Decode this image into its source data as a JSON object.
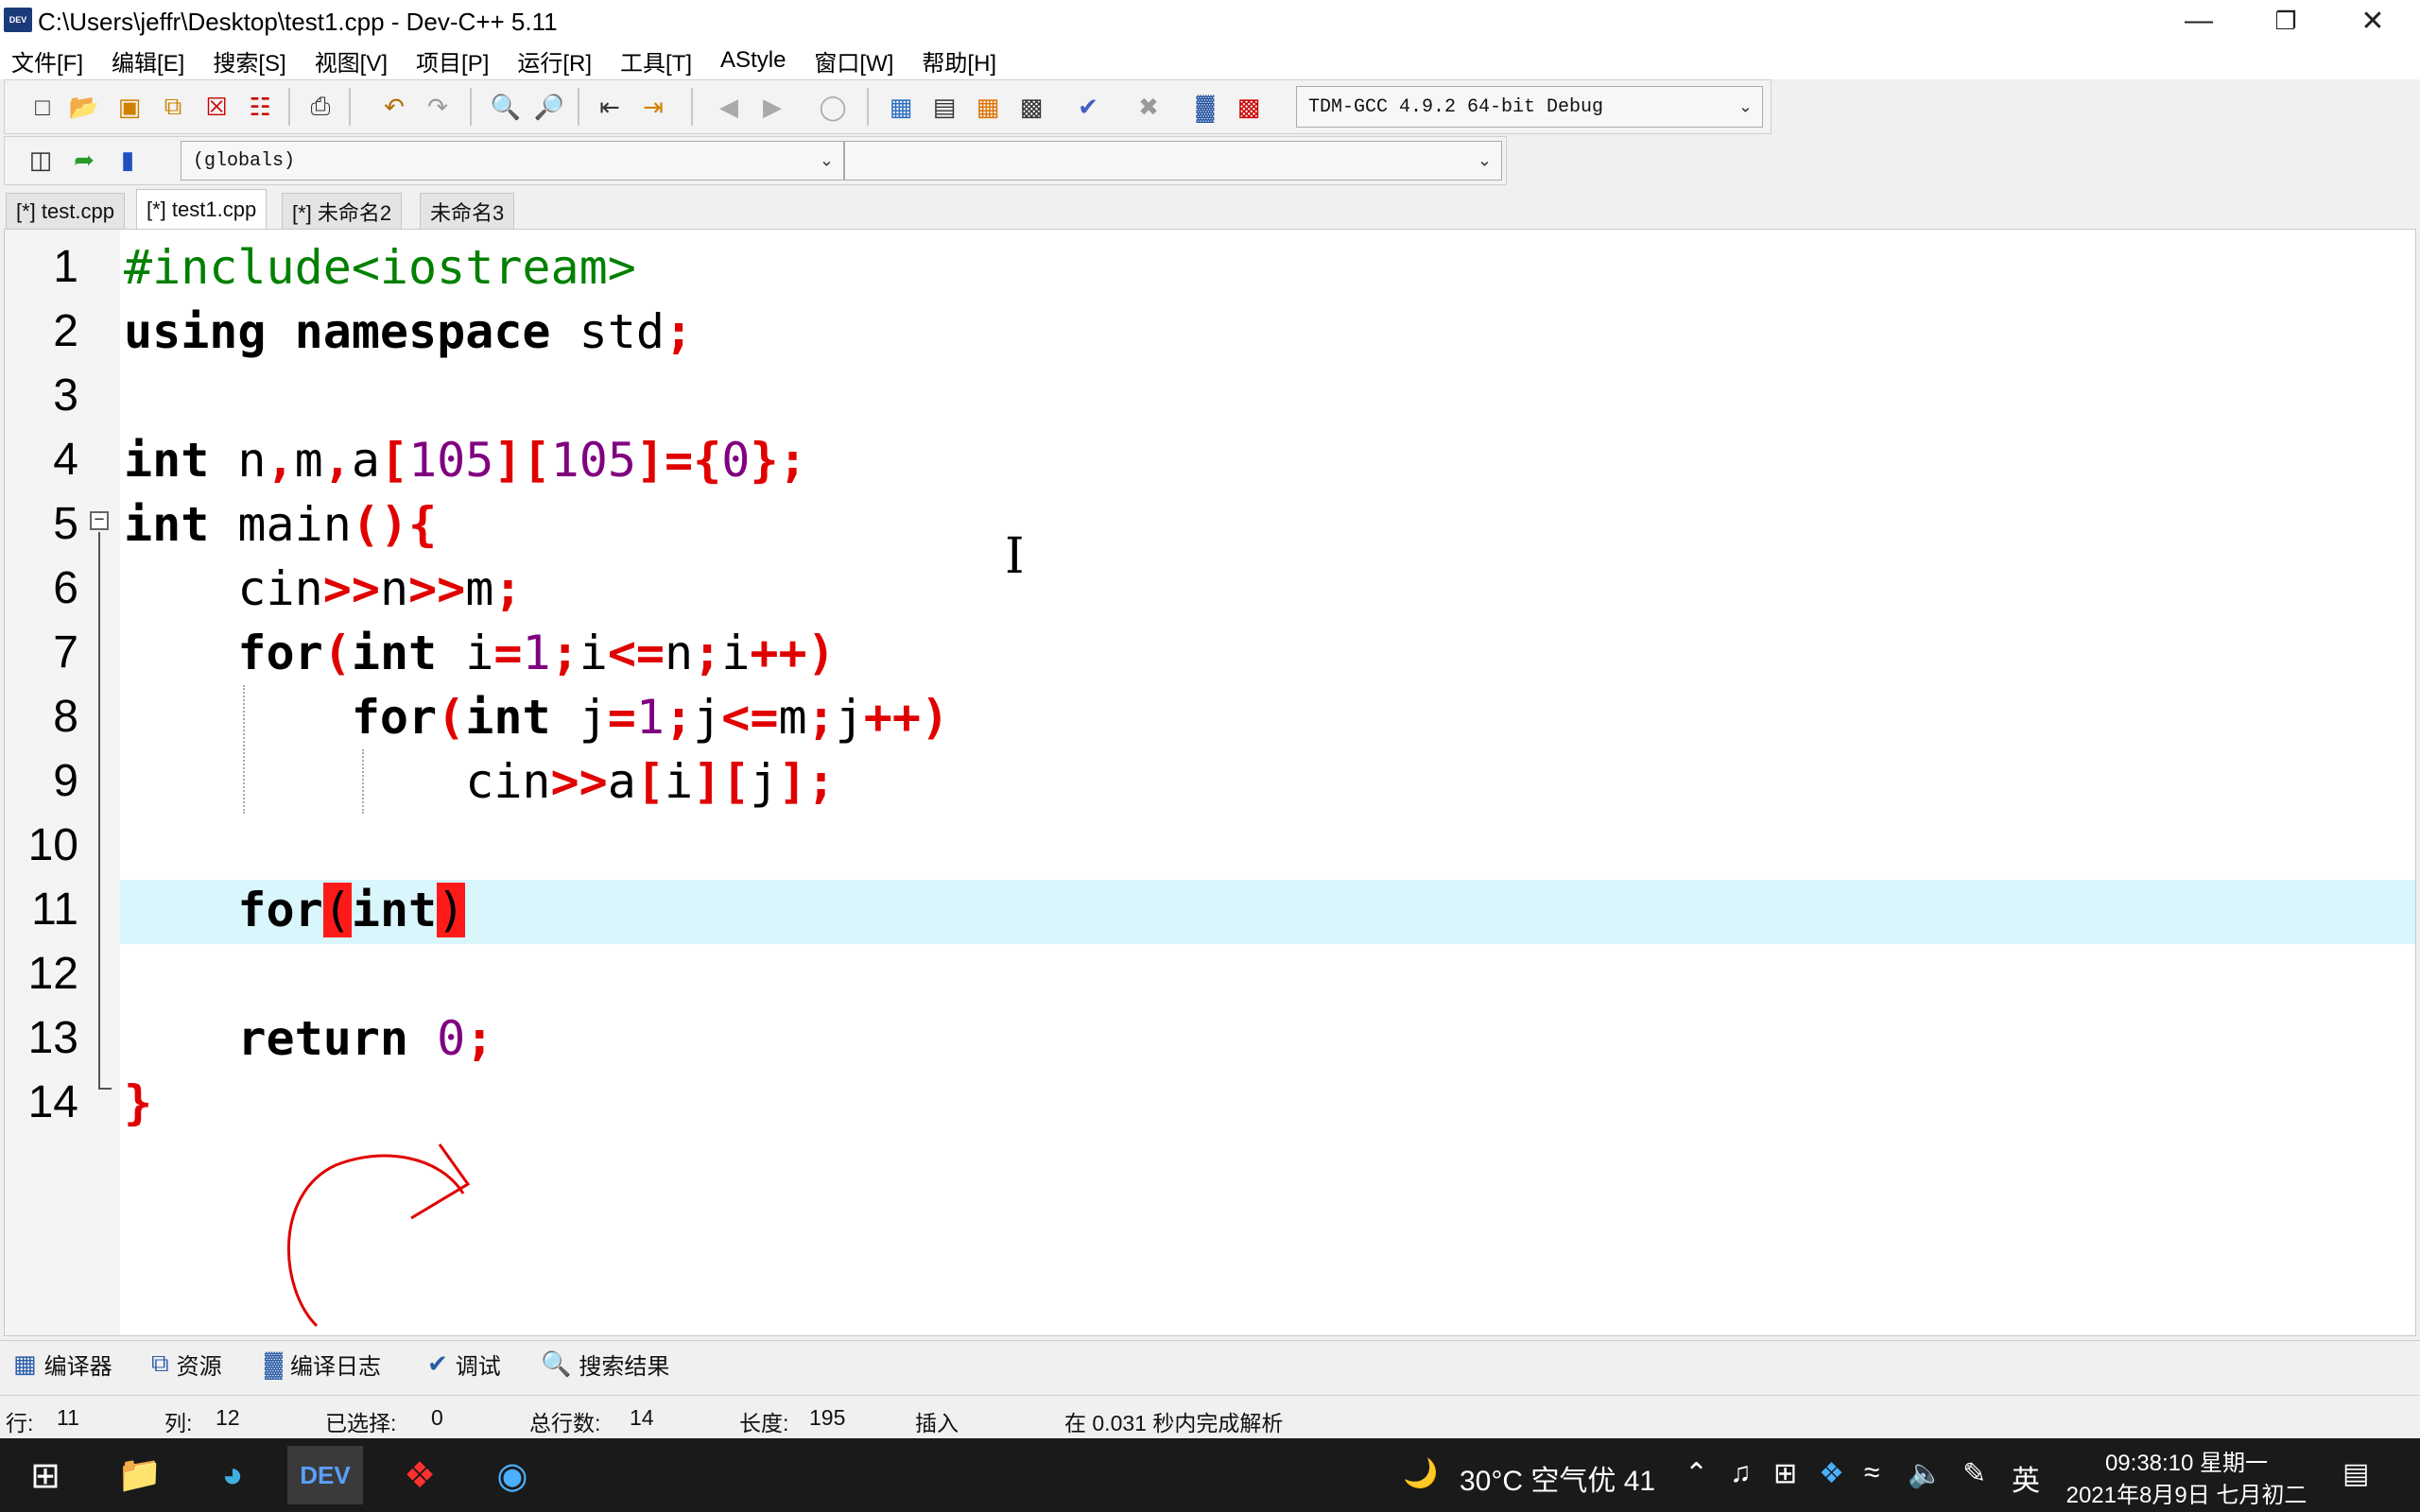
{
  "window": {
    "title": "C:\\Users\\jeffr\\Desktop\\test1.cpp - Dev-C++ 5.11",
    "app_icon_text": "DEV",
    "minimize_icon": "minimize-icon",
    "maximize_icon": "restore-icon",
    "close_icon": "close-icon"
  },
  "menu": [
    "文件[F]",
    "编辑[E]",
    "搜索[S]",
    "视图[V]",
    "项目[P]",
    "运行[R]",
    "工具[T]",
    "AStyle",
    "窗口[W]",
    "帮助[H]"
  ],
  "toolbar": {
    "compiler_select": "TDM-GCC 4.9.2 64-bit Debug",
    "scope_select": "(globals)",
    "member_select": ""
  },
  "tabs": [
    "[*] test.cpp",
    "[*] test1.cpp",
    "[*] 未命名2",
    "未命名3"
  ],
  "active_tab_index": 1,
  "editor": {
    "line_numbers": [
      "1",
      "2",
      "3",
      "4",
      "5",
      "6",
      "7",
      "8",
      "9",
      "10",
      "11",
      "12",
      "13",
      "14"
    ],
    "current_line": 11
  },
  "bottom_tabs": [
    {
      "label": "编译器",
      "icon": "grid-icon"
    },
    {
      "label": "资源",
      "icon": "resources-icon"
    },
    {
      "label": "编译日志",
      "icon": "chart-icon"
    },
    {
      "label": "调试",
      "icon": "check-icon"
    },
    {
      "label": "搜索结果",
      "icon": "search-icon"
    }
  ],
  "status": {
    "row_label": "行:",
    "row_value": "11",
    "col_label": "列:",
    "col_value": "12",
    "sel_label": "已选择:",
    "sel_value": "0",
    "lines_label": "总行数:",
    "lines_value": "14",
    "len_label": "长度:",
    "len_value": "195",
    "mode": "插入",
    "parse_msg": "在 0.031 秒内完成解析"
  },
  "taskbar": {
    "weather": "30°C  空气优 41",
    "ime": "英",
    "time": "09:38:10 星期一",
    "date": "2021年8月9日 七月初二"
  },
  "colors": {
    "keyword": "#000000",
    "preprocessor": "#008000",
    "symbol": "#e00000",
    "number": "#800080",
    "current_line_bg": "#d8f6fb",
    "bracket_match": "#ff1a1a"
  }
}
